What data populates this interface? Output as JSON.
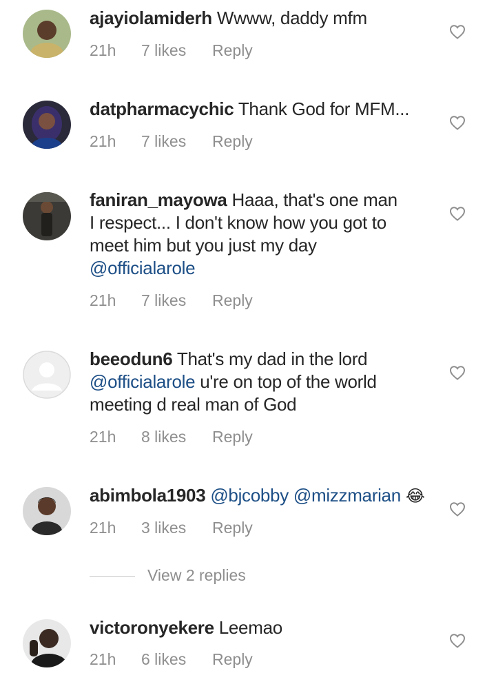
{
  "comments": [
    {
      "username": "ajayiolamiderh",
      "text": "Wwww, daddy mfm",
      "mention": "",
      "time": "21h",
      "likes": "7 likes",
      "reply": "Reply",
      "avatar": "person-photo"
    },
    {
      "username": "datpharmacychic",
      "text": "Thank God for MFM...",
      "mention": "",
      "time": "21h",
      "likes": "7 likes",
      "reply": "Reply",
      "avatar": "person-photo"
    },
    {
      "username": "faniran_mayowa",
      "text": "Haaa, that's one man I respect... I don't know how you got to meet him but you just my day",
      "mention": "@officialarole",
      "time": "21h",
      "likes": "7 likes",
      "reply": "Reply",
      "avatar": "person-photo"
    },
    {
      "username": "beeodun6",
      "text": "That's my dad in the lord",
      "mention": "@officialarole",
      "text_after": "u're on top of the world meeting d real man of God",
      "time": "21h",
      "likes": "8 likes",
      "reply": "Reply",
      "avatar": "default-avatar"
    },
    {
      "username": "abimbola1903",
      "mention": "@bjcobby",
      "mention2": "@mizzmarian",
      "emoji": "😂",
      "time": "21h",
      "likes": "3 likes",
      "reply": "Reply",
      "avatar": "person-photo"
    },
    {
      "username": "victoronyekere",
      "text": "Leemao",
      "time": "21h",
      "likes": "6 likes",
      "reply": "Reply",
      "avatar": "person-photo"
    }
  ],
  "view_replies": "View 2 replies",
  "icons": {
    "like": "heart-outline-icon"
  },
  "colors": {
    "mention": "#1d4f86",
    "meta": "#8e8e8e",
    "text": "#262626"
  }
}
